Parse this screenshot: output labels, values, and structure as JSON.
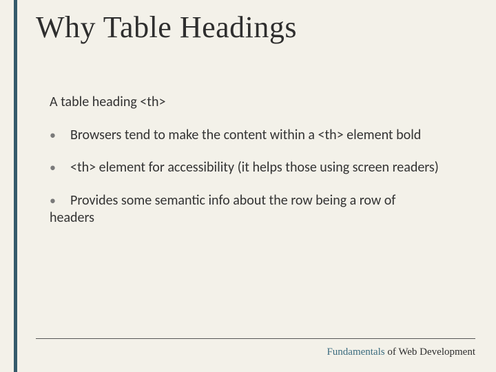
{
  "title": "Why  Table Headings",
  "intro": "A table heading <th>",
  "bullets": [
    "Browsers tend to make the content within a <th> element bold",
    "<th> element for accessibility (it helps those using screen readers)",
    "Provides some semantic info about the row being a row of headers"
  ],
  "footer": {
    "accent": "Fundamentals",
    "rest": " of Web Development"
  }
}
